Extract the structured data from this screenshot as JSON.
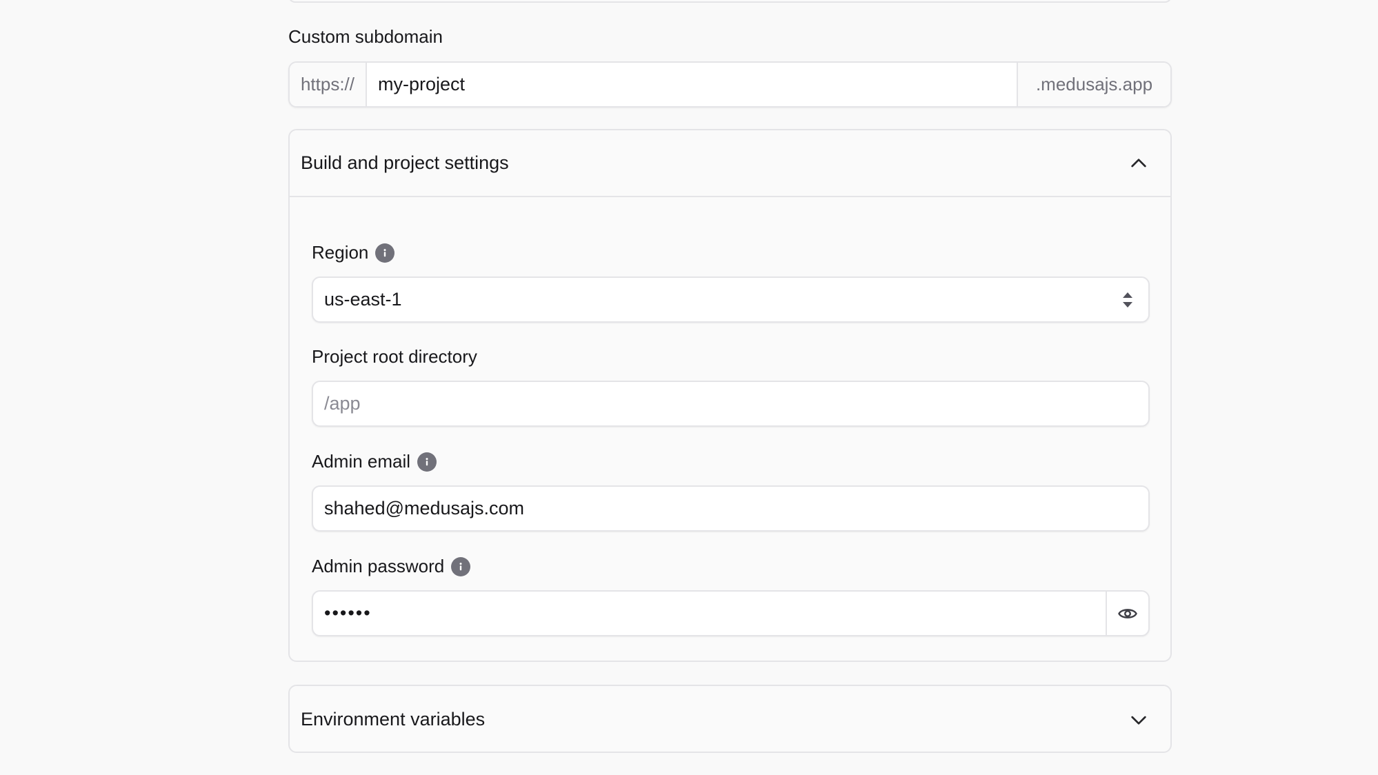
{
  "subdomain": {
    "label": "Custom subdomain",
    "prefix": "https://",
    "value": "my-project",
    "suffix": ".medusajs.app"
  },
  "build_settings": {
    "title": "Build and project settings",
    "expanded": true,
    "region": {
      "label": "Region",
      "value": "us-east-1",
      "icon": "info-icon"
    },
    "root_dir": {
      "label": "Project root directory",
      "placeholder": "/app"
    },
    "admin_email": {
      "label": "Admin email",
      "value": "shahed@medusajs.com",
      "icon": "info-icon"
    },
    "admin_password": {
      "label": "Admin password",
      "masked_value": "••••••",
      "icon": "info-icon",
      "toggle_icon": "eye-icon"
    }
  },
  "env_variables": {
    "title": "Environment variables",
    "expanded": false
  }
}
